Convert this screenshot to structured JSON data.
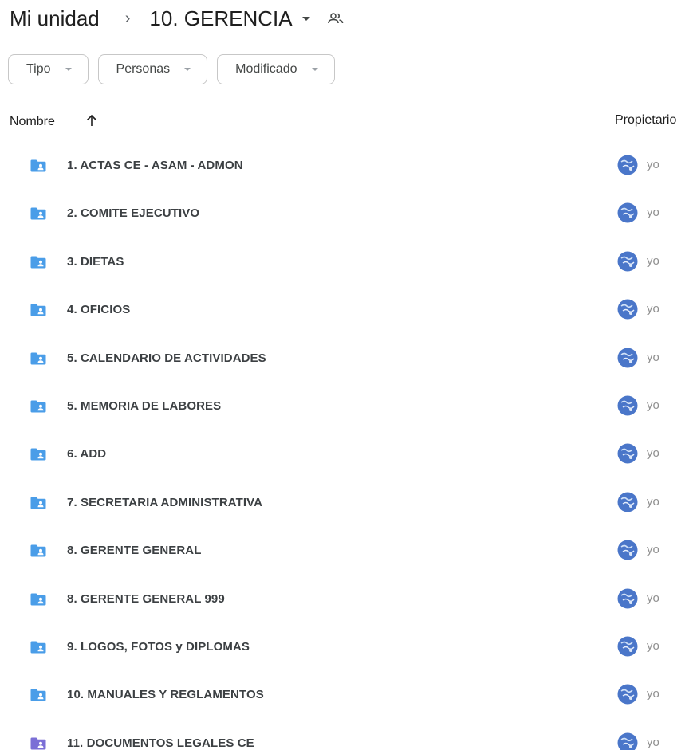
{
  "breadcrumb": {
    "root": "Mi unidad",
    "separator": "›",
    "current": "10. GERENCIA"
  },
  "filters": [
    {
      "label": "Tipo"
    },
    {
      "label": "Personas"
    },
    {
      "label": "Modificado"
    }
  ],
  "header": {
    "name": "Nombre",
    "owner": "Propietario"
  },
  "colors": {
    "shared_folder": "#4a9de8",
    "legal_folder": "#7b6fd6",
    "avatar": "#4a76c9"
  },
  "rows": [
    {
      "name": "1. ACTAS CE - ASAM - ADMON",
      "owner": "yo",
      "icon": "shared-folder-icon"
    },
    {
      "name": "2. COMITE EJECUTIVO",
      "owner": "yo",
      "icon": "shared-folder-icon"
    },
    {
      "name": "3. DIETAS",
      "owner": "yo",
      "icon": "shared-folder-icon"
    },
    {
      "name": "4. OFICIOS",
      "owner": "yo",
      "icon": "shared-folder-icon"
    },
    {
      "name": "5. CALENDARIO DE ACTIVIDADES",
      "owner": "yo",
      "icon": "shared-folder-icon"
    },
    {
      "name": "5. MEMORIA DE LABORES",
      "owner": "yo",
      "icon": "shared-folder-icon"
    },
    {
      "name": "6. ADD",
      "owner": "yo",
      "icon": "shared-folder-icon"
    },
    {
      "name": "7. SECRETARIA ADMINISTRATIVA",
      "owner": "yo",
      "icon": "shared-folder-icon"
    },
    {
      "name": "8. GERENTE GENERAL",
      "owner": "yo",
      "icon": "shared-folder-icon"
    },
    {
      "name": "8. GERENTE GENERAL 999",
      "owner": "yo",
      "icon": "shared-folder-icon"
    },
    {
      "name": "9. LOGOS, FOTOS y DIPLOMAS",
      "owner": "yo",
      "icon": "shared-folder-icon"
    },
    {
      "name": "10. MANUALES Y REGLAMENTOS",
      "owner": "yo",
      "icon": "shared-folder-icon"
    },
    {
      "name": "11. DOCUMENTOS LEGALES CE",
      "owner": "yo",
      "icon": "shared-folder-icon",
      "color": "legal"
    }
  ]
}
